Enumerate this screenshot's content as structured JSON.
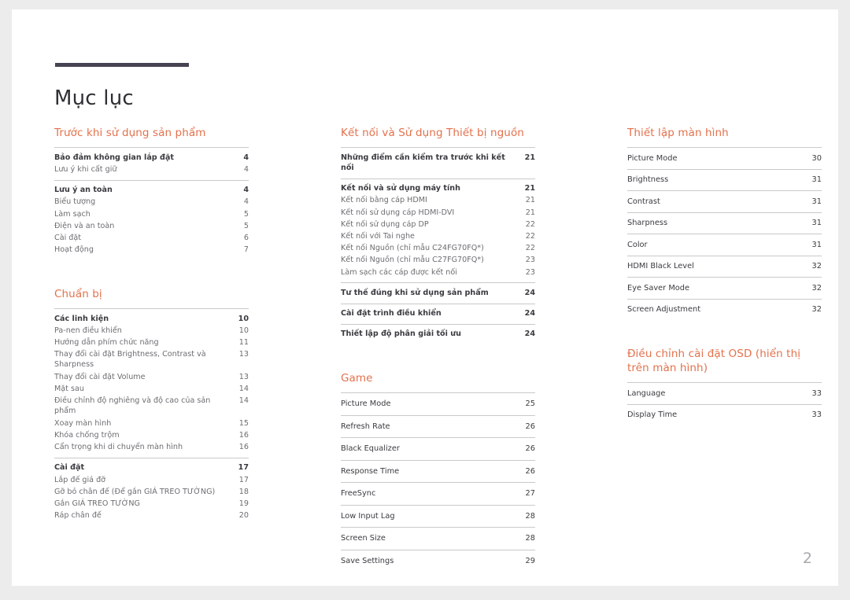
{
  "document": {
    "title": "Mục lục",
    "page_number": "2",
    "accent_color": "#e3714c",
    "rule_color": "#474352"
  },
  "columns": [
    {
      "id": "column-1",
      "sections": [
        {
          "title": "Trước khi sử dụng sản phẩm",
          "style": "blocks",
          "blocks": [
            {
              "entries": [
                {
                  "label": "Bảo đảm không gian lắp đặt",
                  "page": "4",
                  "head": true
                },
                {
                  "label": "Lưu ý khi cất giữ",
                  "page": "4",
                  "head": false
                }
              ]
            },
            {
              "entries": [
                {
                  "label": "Lưu ý an toàn",
                  "page": "4",
                  "head": true
                },
                {
                  "label": "Biểu tượng",
                  "page": "4",
                  "head": false
                },
                {
                  "label": "Làm sạch",
                  "page": "5",
                  "head": false
                },
                {
                  "label": "Điện và an toàn",
                  "page": "5",
                  "head": false
                },
                {
                  "label": "Cài đặt",
                  "page": "6",
                  "head": false
                },
                {
                  "label": "Hoạt động",
                  "page": "7",
                  "head": false
                }
              ]
            }
          ]
        },
        {
          "title": "Chuẩn bị",
          "style": "blocks",
          "blocks": [
            {
              "entries": [
                {
                  "label": "Các linh kiện",
                  "page": "10",
                  "head": true
                },
                {
                  "label": "Pa-nen điều khiển",
                  "page": "10",
                  "head": false
                },
                {
                  "label": "Hướng dẫn phím chức năng",
                  "page": "11",
                  "head": false
                },
                {
                  "label": "Thay đổi cài đặt Brightness, Contrast và Sharpness",
                  "page": "13",
                  "head": false
                },
                {
                  "label": "Thay đổi cài đặt Volume",
                  "page": "13",
                  "head": false
                },
                {
                  "label": "Mặt sau",
                  "page": "14",
                  "head": false
                },
                {
                  "label": "Điều chỉnh độ nghiêng và độ cao của sản phẩm",
                  "page": "14",
                  "head": false
                },
                {
                  "label": "Xoay màn hình",
                  "page": "15",
                  "head": false
                },
                {
                  "label": "Khóa chống trộm",
                  "page": "16",
                  "head": false
                },
                {
                  "label": "Cẩn trọng khi di chuyển màn hình",
                  "page": "16",
                  "head": false
                }
              ]
            },
            {
              "entries": [
                {
                  "label": "Cài đặt",
                  "page": "17",
                  "head": true
                },
                {
                  "label": "Lắp đế giá đỡ",
                  "page": "17",
                  "head": false
                },
                {
                  "label": "Gỡ bỏ chân đế (Để gắn GIÁ TREO TƯỜNG)",
                  "page": "18",
                  "head": false
                },
                {
                  "label": "Gắn GIÁ TREO TƯỜNG",
                  "page": "19",
                  "head": false
                },
                {
                  "label": "Ráp chân đế",
                  "page": "20",
                  "head": false
                }
              ]
            }
          ]
        }
      ]
    },
    {
      "id": "column-2",
      "sections": [
        {
          "title": "Kết nối và Sử dụng Thiết bị nguồn",
          "style": "blocks",
          "blocks": [
            {
              "entries": [
                {
                  "label": "Những điểm cần kiểm tra trước khi kết nối",
                  "page": "21",
                  "head": true
                }
              ]
            },
            {
              "entries": [
                {
                  "label": "Kết nối và sử dụng máy tính",
                  "page": "21",
                  "head": true
                },
                {
                  "label": "Kết nối bằng cáp HDMI",
                  "page": "21",
                  "head": false
                },
                {
                  "label": "Kết nối sử dụng cáp HDMI-DVI",
                  "page": "21",
                  "head": false
                },
                {
                  "label": "Kết nối sử dụng cáp DP",
                  "page": "22",
                  "head": false
                },
                {
                  "label": "Kết nối với Tai nghe",
                  "page": "22",
                  "head": false
                },
                {
                  "label": "Kết nối Nguồn (chỉ mẫu C24FG70FQ*)",
                  "page": "22",
                  "head": false
                },
                {
                  "label": "Kết nối Nguồn (chỉ mẫu C27FG70FQ*)",
                  "page": "23",
                  "head": false
                },
                {
                  "label": "Làm sạch các cáp được kết nối",
                  "page": "23",
                  "head": false
                }
              ]
            },
            {
              "entries": [
                {
                  "label": "Tư thế đúng khi sử dụng sản phẩm",
                  "page": "24",
                  "head": true
                }
              ]
            },
            {
              "entries": [
                {
                  "label": "Cài đặt trình điều khiển",
                  "page": "24",
                  "head": true
                }
              ]
            },
            {
              "entries": [
                {
                  "label": "Thiết lập độ phân giải tối ưu",
                  "page": "24",
                  "head": true
                }
              ]
            }
          ]
        },
        {
          "title": "Game",
          "style": "ruled-alt",
          "entries": [
            {
              "label": "Picture Mode",
              "page": "25"
            },
            {
              "label": "Refresh Rate",
              "page": "26"
            },
            {
              "label": "Black Equalizer",
              "page": "26"
            },
            {
              "label": "Response Time",
              "page": "26"
            },
            {
              "label": "FreeSync",
              "page": "27"
            },
            {
              "label": "Low Input Lag",
              "page": "28"
            },
            {
              "label": "Screen Size",
              "page": "28"
            },
            {
              "label": "Save Settings",
              "page": "29"
            }
          ]
        }
      ]
    },
    {
      "id": "column-3",
      "sections": [
        {
          "title": "Thiết lập màn hình",
          "style": "ruled",
          "entries": [
            {
              "label": "Picture Mode",
              "page": "30"
            },
            {
              "label": "Brightness",
              "page": "31"
            },
            {
              "label": "Contrast",
              "page": "31"
            },
            {
              "label": "Sharpness",
              "page": "31"
            },
            {
              "label": "Color",
              "page": "31"
            },
            {
              "label": "HDMI Black Level",
              "page": "32"
            },
            {
              "label": "Eye Saver Mode",
              "page": "32"
            },
            {
              "label": "Screen Adjustment",
              "page": "32"
            }
          ]
        },
        {
          "title": "Điều chỉnh cài đặt OSD (hiển thị trên màn hình)",
          "style": "ruled",
          "entries": [
            {
              "label": "Language",
              "page": "33"
            },
            {
              "label": "Display Time",
              "page": "33"
            }
          ]
        }
      ]
    }
  ]
}
